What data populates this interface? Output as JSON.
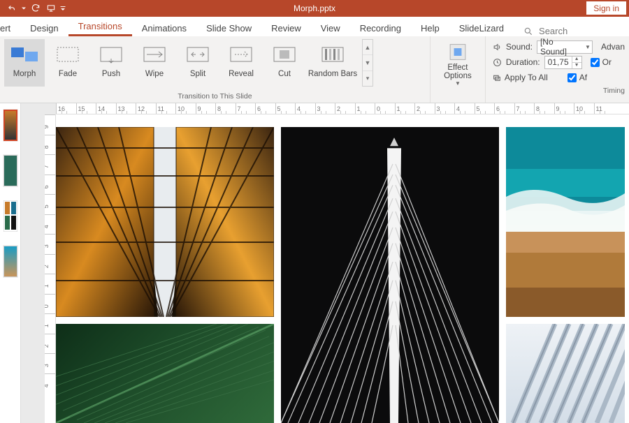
{
  "title": "Morph.pptx",
  "signin": "Sign in",
  "tabs": {
    "ert": "ert",
    "design": "Design",
    "transitions": "Transitions",
    "animations": "Animations",
    "slideshow": "Slide Show",
    "review": "Review",
    "view": "View",
    "recording": "Recording",
    "help": "Help",
    "slidelizard": "SlideLizard"
  },
  "search": {
    "placeholder": "Search"
  },
  "ribbon": {
    "gallery": {
      "morph": "Morph",
      "fade": "Fade",
      "push": "Push",
      "wipe": "Wipe",
      "split": "Split",
      "reveal": "Reveal",
      "cut": "Cut",
      "random": "Random Bars"
    },
    "group_transition": "Transition to This Slide",
    "effect_options": "Effect",
    "effect_options2": "Options",
    "sound_label": "Sound:",
    "sound_value": "[No Sound]",
    "duration_label": "Duration:",
    "duration_value": "01,75",
    "apply_all": "Apply To All",
    "advance": "Advan",
    "on_click": "Or",
    "after": "Af",
    "group_timing": "Timing"
  },
  "ruler_h": [
    "16",
    "15",
    "14",
    "13",
    "12",
    "11",
    "10",
    "9",
    "8",
    "7",
    "6",
    "5",
    "4",
    "3",
    "2",
    "1",
    "0",
    "1",
    "2",
    "3",
    "4",
    "5",
    "6",
    "7",
    "8",
    "9",
    "10",
    "11"
  ],
  "ruler_v": [
    "9",
    "8",
    "7",
    "6",
    "5",
    "4",
    "3",
    "2",
    "1",
    "0",
    "1",
    "2",
    "3",
    "4"
  ]
}
